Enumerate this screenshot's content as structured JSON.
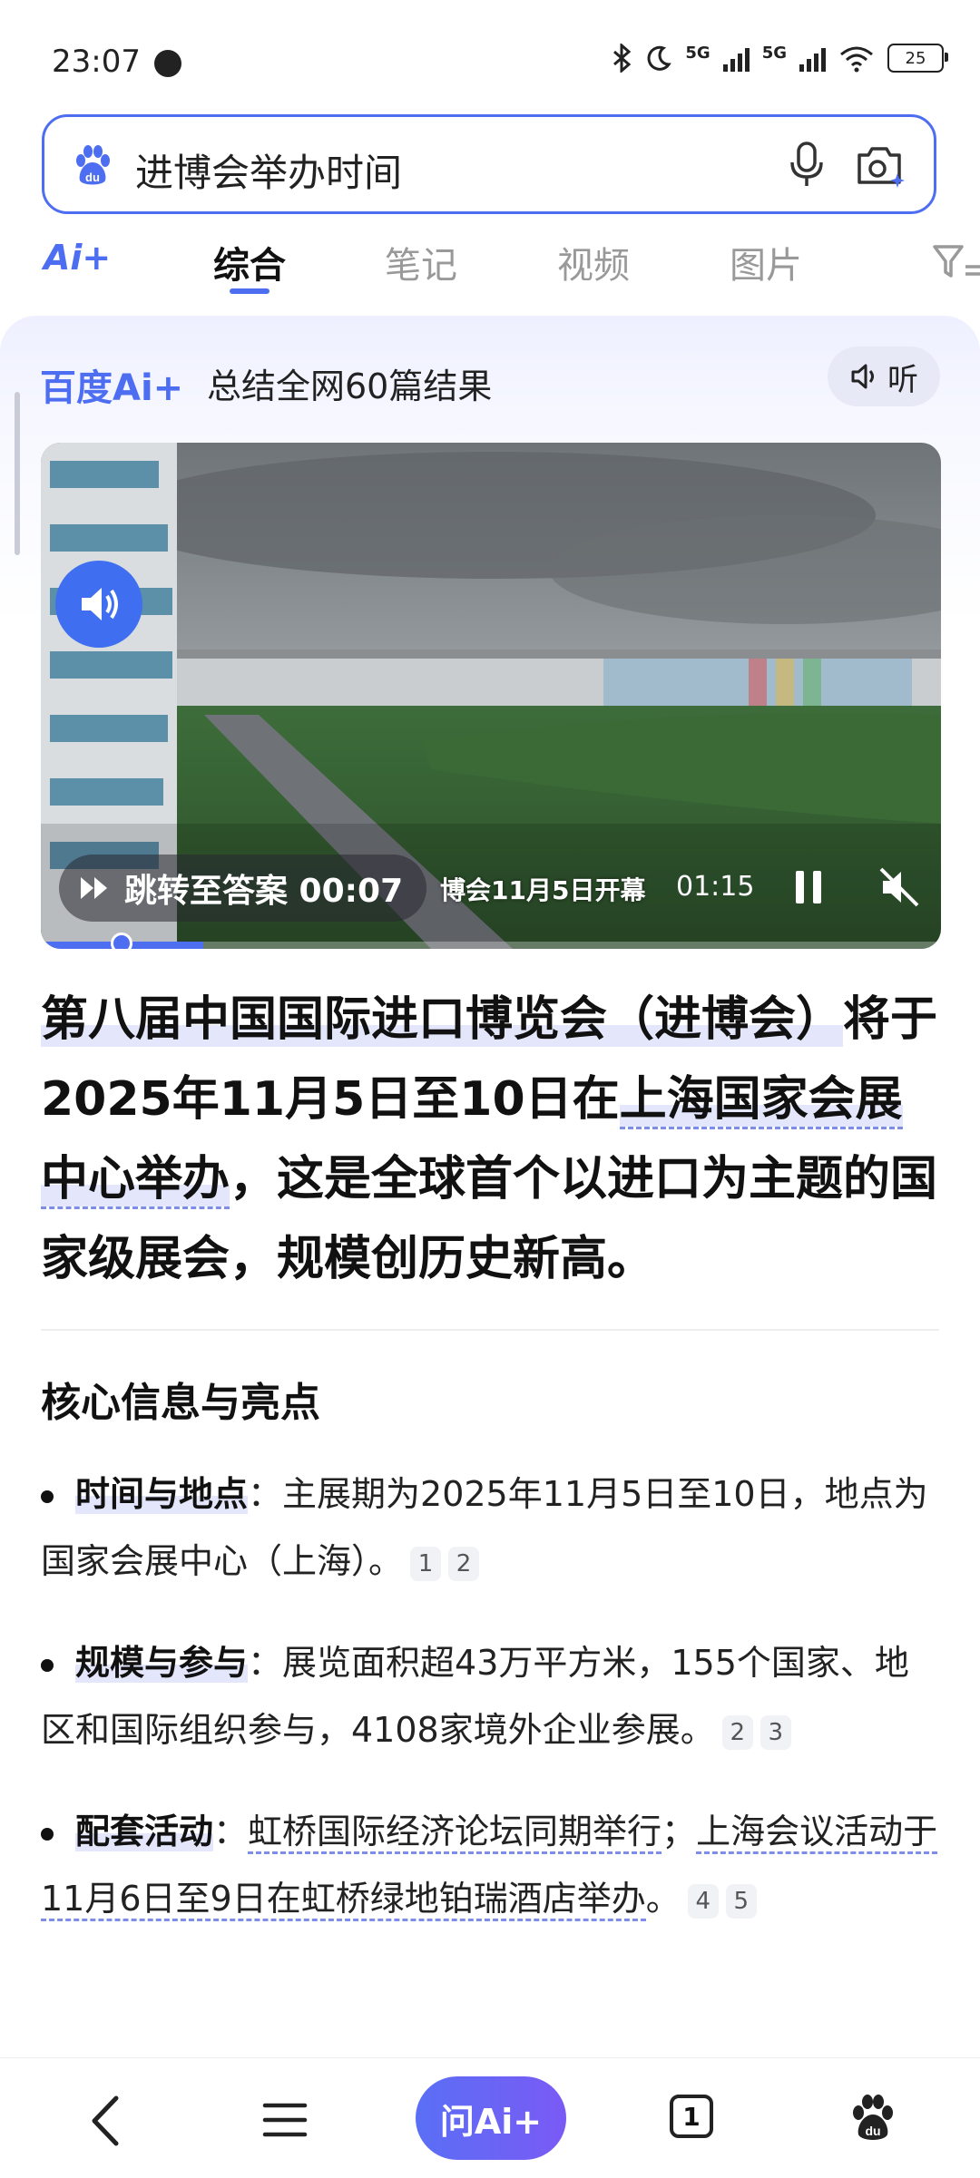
{
  "status_bar": {
    "time": "23:07",
    "network": "5G",
    "network2": "5G",
    "battery": "25"
  },
  "search": {
    "query": "进博会举办时间",
    "logo_icon": "baidu-paw-icon",
    "mic_icon": "microphone-icon",
    "camera_icon": "camera-search-icon"
  },
  "tabs": {
    "ai_label": "Ai+",
    "items": [
      "综合",
      "笔记",
      "视频",
      "图片"
    ],
    "active": "综合"
  },
  "ai_card": {
    "brand": "百度Ai+",
    "summary": "总结全网60篇结果",
    "listen": "听"
  },
  "video": {
    "jump_label": "跳转至答案 00:07",
    "caption": "博会11月5日开幕",
    "duration": "01:15",
    "progress": 0.18
  },
  "answer": {
    "part1": "第八届中国国际进口博览会（进博会）",
    "part2": "将于2025年11月5日至10日在",
    "part3": "上海国家会展中心举办",
    "part4": "，这是全球首个以进口为主题的国家级展会，规模创历史新高。"
  },
  "section": {
    "title": "核心信息与亮点",
    "bullets": [
      {
        "key": "时间与地点",
        "text": "：主展期为2025年11月5日至10日，地点为国家会展中心（上海）。",
        "cites": [
          "1",
          "2"
        ]
      },
      {
        "key": "规模与参与",
        "text": "：展览面积超43万平方米，155个国家、地区和国际组织参与，4108家境外企业参展。",
        "cites": [
          "2",
          "3"
        ]
      },
      {
        "key": "配套活动",
        "text_a": "：",
        "link_a": "虹桥国际经济论坛同期举行",
        "text_b": "；",
        "link_b": "上海会议活动于11月6日至9日在虹桥绿地铂瑞酒店举办",
        "text_c": "。",
        "cites": [
          "4",
          "5"
        ]
      }
    ]
  },
  "bottom_nav": {
    "ask_ai": "问Ai+",
    "tab_count": "1"
  },
  "colors": {
    "accent": "#4e6ef2",
    "highlight": "#e4e7fb"
  }
}
